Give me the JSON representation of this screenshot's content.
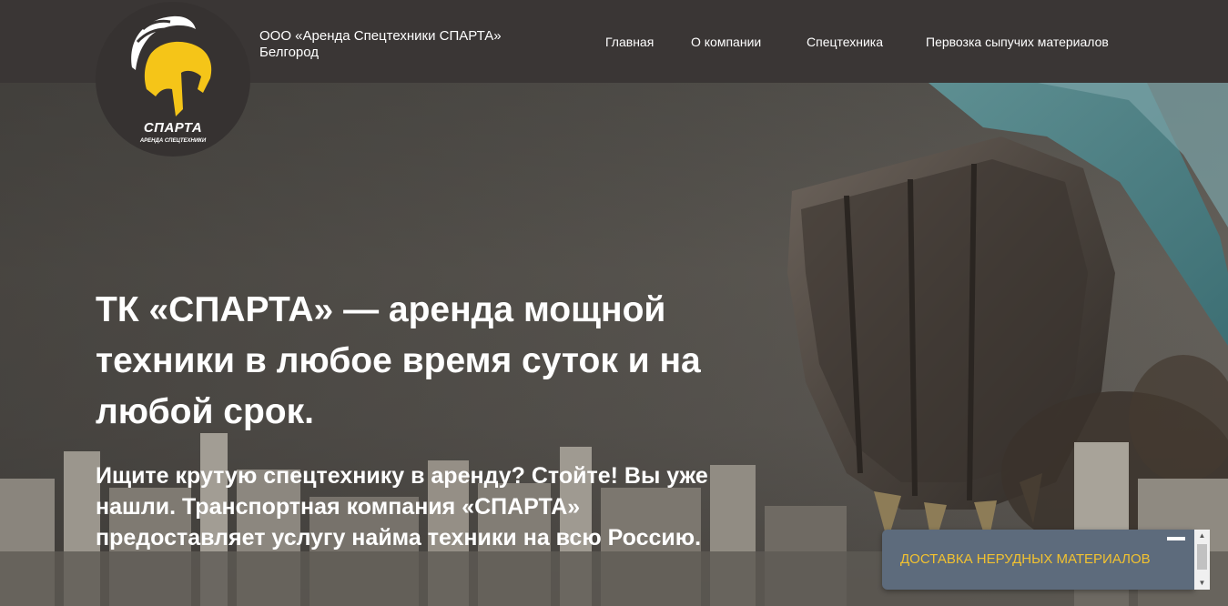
{
  "header": {
    "company_line1": "ООО «Аренда Спецтехники СПАРТА»",
    "company_line2": "Белгород",
    "logo": {
      "title": "СПАРТА",
      "subtitle": "АРЕНДА СПЕЦТЕХНИКИ",
      "icon": "spartan-helmet-icon"
    }
  },
  "nav": {
    "items": [
      {
        "label": "Главная"
      },
      {
        "label": "О компании"
      },
      {
        "label": "Спецтехника"
      },
      {
        "label": "Первозка сыпучих материалов"
      }
    ]
  },
  "hero": {
    "headline": "ТК «СПАРТА» — аренда мощной техники в любое время суток и на любой срок.",
    "lead": "Ищите крутую спецтехнику в аренду? Стойте! Вы уже нашли. Транспортная компания «СПАРТА» предоставляет услугу найма техники на всю Россию."
  },
  "widget": {
    "label": "ДОСТАВКА НЕРУДНЫХ МАТЕРИАЛОВ"
  },
  "colors": {
    "header_bg": "#3a3635",
    "accent_yellow": "#f2c230",
    "widget_bg": "#5d6b7c",
    "text": "#ffffff"
  }
}
